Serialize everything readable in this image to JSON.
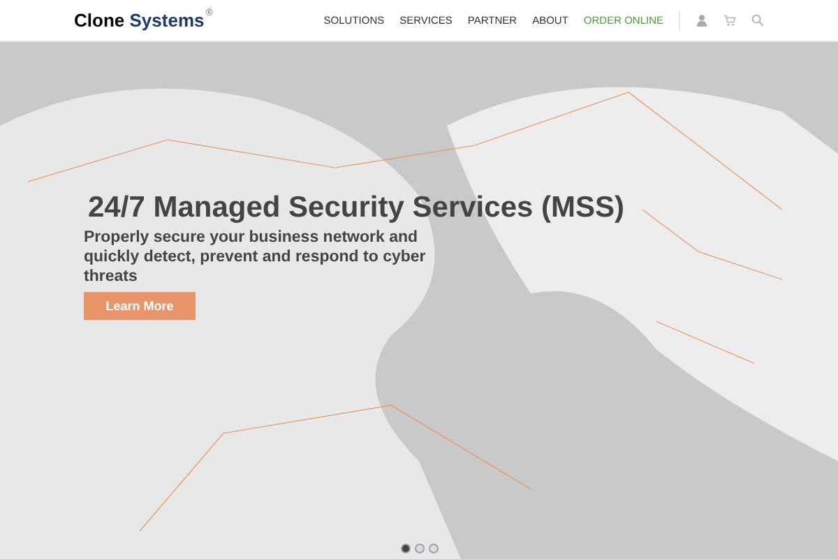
{
  "header": {
    "logo": {
      "word1": "Clone",
      "word2": "Systems",
      "mark": "®"
    },
    "nav": [
      {
        "label": "SOLUTIONS",
        "kind": "link"
      },
      {
        "label": "SERVICES",
        "kind": "link"
      },
      {
        "label": "PARTNER",
        "kind": "link"
      },
      {
        "label": "ABOUT",
        "kind": "link"
      },
      {
        "label": "ORDER ONLINE",
        "kind": "highlight"
      }
    ]
  },
  "hero": {
    "title": "24/7 Managed Security Services (MSS)",
    "subtitle": "Properly secure your business network and quickly detect, prevent and respond to cyber threats",
    "button": "Learn More",
    "slides": [
      {
        "selected": true
      },
      {
        "selected": false
      },
      {
        "selected": false
      }
    ]
  }
}
